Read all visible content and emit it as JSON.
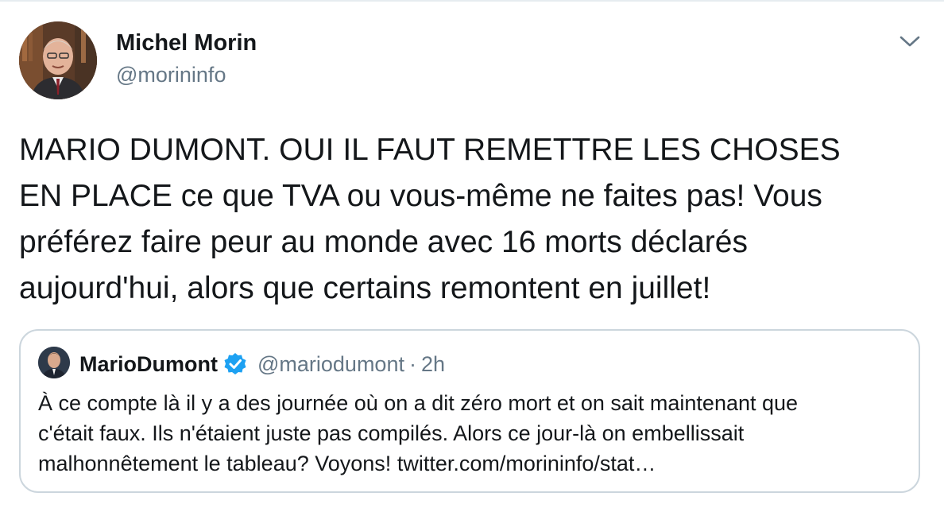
{
  "tweet": {
    "author_name": "Michel Morin",
    "author_handle": "@morininfo",
    "text": "MARIO DUMONT. OUI IL FAUT REMETTRE LES CHOSES\nEN PLACE ce que TVA ou vous-même ne faites pas! Vous\npréférez faire peur au monde avec 16 morts déclarés\naujourd'hui,  alors que certains remontent en juillet!",
    "menu_icon": "chevron-down-icon"
  },
  "quoted_tweet": {
    "author_name": "MarioDumont",
    "verified_icon": "verified-badge-icon",
    "author_handle": "@mariodumont",
    "separator": "·",
    "time": "2h",
    "text": "À ce compte là il y a des journée où on a dit zéro mort et on sait maintenant que\nc'était faux.  Ils n'étaient juste pas compilés.  Alors ce jour-là on embellissait\nmalhonnêtement le tableau? Voyons! twitter.com/morininfo/stat…"
  },
  "colors": {
    "text_primary": "#14171a",
    "text_secondary": "#657786",
    "border": "#ccd6dd",
    "verified_blue": "#1da1f2"
  }
}
